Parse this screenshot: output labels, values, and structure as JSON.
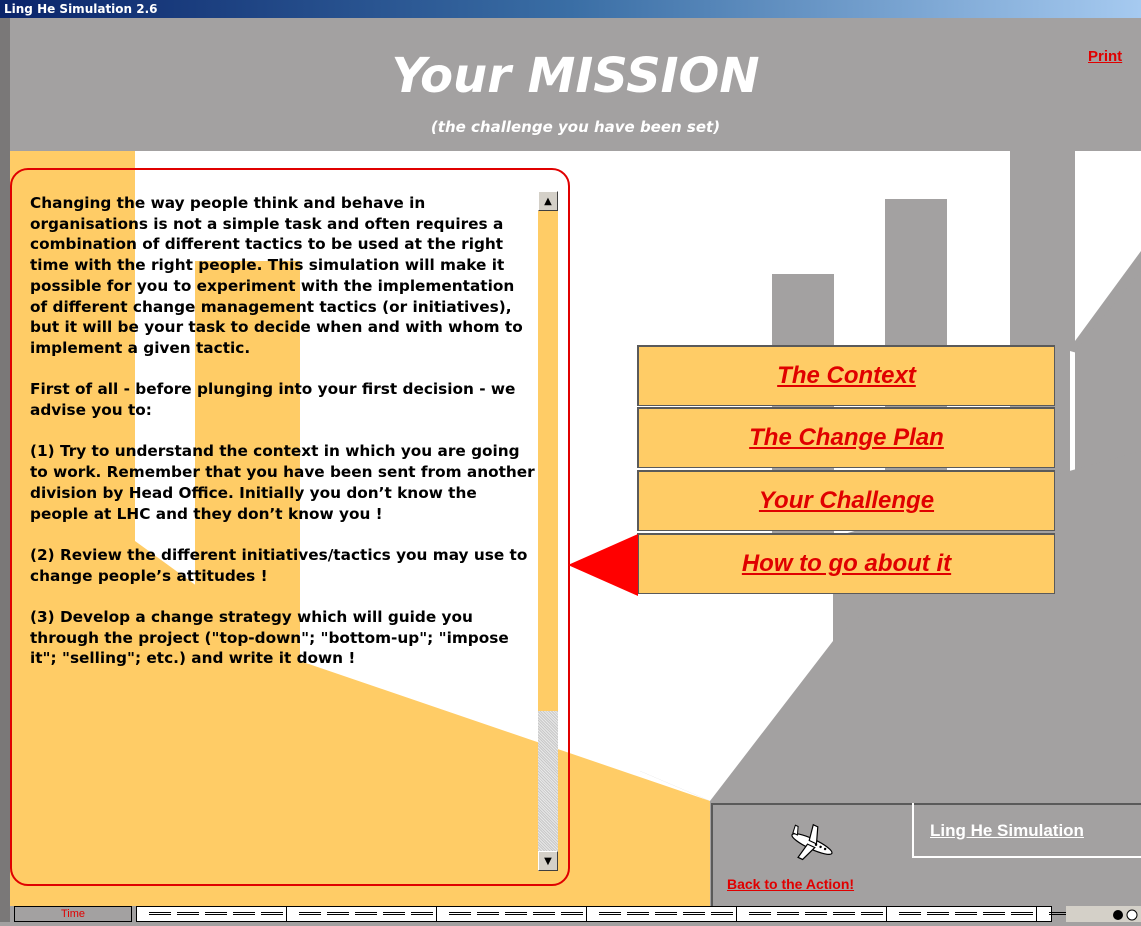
{
  "window": {
    "title": "Ling He Simulation 2.6"
  },
  "header": {
    "title": "Your MISSION",
    "subtitle": "(the challenge you have been set)",
    "print_label": "Print"
  },
  "mission_text": {
    "paragraphs": [
      "Changing the way people think and behave in organisations is not a simple task and often requires a combination of different tactics to be used at the right time with the right people. This simulation will make it possible for you to experiment with the implementation of different change management tactics (or initiatives), but it will be your task to decide when and with whom to implement a given tactic.",
      "First of all - before plunging into your first decision - we advise you to:",
      "(1)  Try to understand the context in which you are going to work. Remember that you have been sent from another division by Head Office. Initially you don’t know the people at LHC and they don’t know you !",
      "(2)  Review the different initiatives/tactics you may use to change people’s attitudes !",
      "(3)  Develop a change strategy which will guide you through the project (\"top-down\";  \"bottom-up\"; \"impose it\"; \"selling\"; etc.) and write it down !"
    ]
  },
  "menu": {
    "items": [
      {
        "label": "The Context"
      },
      {
        "label": "The Change Plan"
      },
      {
        "label": "Your Challenge"
      },
      {
        "label": "How to go about it"
      }
    ],
    "selected": "How to go about it"
  },
  "bottom": {
    "back_label": "Back to the Action!",
    "plane_icon": "airplane-icon",
    "ling_he_label": "Ling He Simulation"
  },
  "status": {
    "time_label": "Time"
  },
  "colors": {
    "accent": "#e00000",
    "panel": "#ffcc66",
    "background": "#a3a1a1"
  }
}
